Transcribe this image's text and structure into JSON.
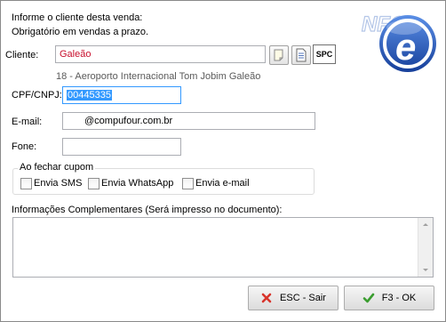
{
  "header": {
    "line1": "Informe o cliente desta venda:",
    "line2": "Obrigatório em vendas a prazo."
  },
  "logo": {
    "text": "NFC",
    "letter": "e"
  },
  "cliente": {
    "label": "Cliente:",
    "value": "Galeão",
    "subtitle": "18 - Aeroporto Internacional Tom Jobim Galeão",
    "spc_label": "SPC"
  },
  "cpf": {
    "label": "CPF/CNPJ:",
    "value": "00445335"
  },
  "email": {
    "label": "E-mail:",
    "value": "@compufour.com.br"
  },
  "fone": {
    "label": "Fone:",
    "value": ""
  },
  "fechar_cupom": {
    "legend": "Ao fechar cupom",
    "options": [
      {
        "label": "Envia SMS",
        "checked": false
      },
      {
        "label": "Envia WhatsApp",
        "checked": false
      },
      {
        "label": "Envia e-mail",
        "checked": false
      }
    ]
  },
  "info": {
    "label": "Informações Complementares (Será impresso no documento):",
    "value": ""
  },
  "buttons": {
    "cancel": "ESC - Sair",
    "ok": "F3 - OK"
  },
  "colors": {
    "selection": "#3399ff",
    "client_name": "#c8102e",
    "logo_blue": "#1f56b8",
    "ok_green": "#3a9d2f",
    "cancel_red": "#d8342b"
  }
}
